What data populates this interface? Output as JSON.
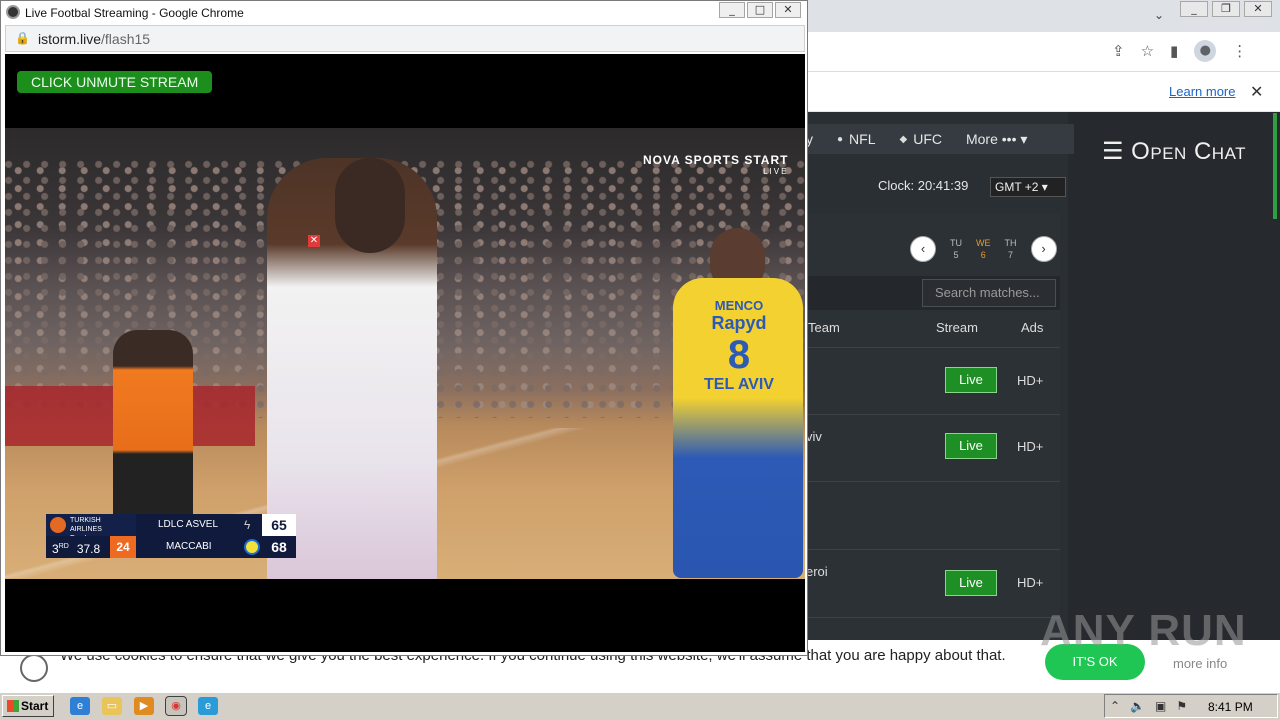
{
  "popup": {
    "title": "Live Footbal Streaming - Google Chrome",
    "url_host": "istorm.live",
    "url_path": "/flash15",
    "unmute_label": "CLICK UNMUTE STREAM",
    "window_buttons": [
      "_",
      "□",
      "✕"
    ]
  },
  "broadcast": {
    "channel": "NOVA SPORTS START",
    "channel_sub": "LIVE",
    "league": "TURKISH AIRLINES EuroLeague",
    "team1": "LDLC ASVEL",
    "score1": "65",
    "team2": "MACCABI",
    "score2": "68",
    "period": "3",
    "period_suffix": "RD",
    "game_clock": "37.8",
    "shot_clock": "24",
    "jersey_name": "MENCO",
    "jersey_brand": "Rapyd",
    "jersey_number": "8",
    "jersey_city": "TEL AVIV"
  },
  "site": {
    "nav": [
      {
        "icon": "",
        "label": "y"
      },
      {
        "icon": "●",
        "label": "NFL"
      },
      {
        "icon": "◆",
        "label": "UFC"
      },
      {
        "icon": "",
        "label": "More ••• ▾"
      }
    ],
    "open_chat": "☰ Open Chat",
    "clock": "Clock: 20:41:39",
    "timezone": "GMT +2 ▾",
    "days": [
      {
        "dow": "TU",
        "num": "5"
      },
      {
        "dow": "WE",
        "num": "6"
      },
      {
        "dow": "TH",
        "num": "7"
      }
    ],
    "search_placeholder": "Search matches...",
    "columns": {
      "team": "Team",
      "stream": "Stream",
      "ads": "Ads"
    },
    "rows": [
      {
        "team": "",
        "live": "Live",
        "ads": "HD+"
      },
      {
        "team": "viv",
        "live": "Live",
        "ads": "HD+"
      },
      {
        "team": "",
        "live": "",
        "ads": ""
      },
      {
        "team": "eroi",
        "live": "Live",
        "ads": "HD+"
      }
    ]
  },
  "notice": {
    "learn_more": "Learn more",
    "close": "✕"
  },
  "cookie": {
    "text": "We use cookies to ensure that we give you the best experience. If you continue using this website, we'll assume that you are happy about that.",
    "ok": "IT'S OK",
    "more": "more info"
  },
  "watermark": "ANY RUN",
  "taskbar": {
    "start": "Start",
    "time": "8:41 PM"
  },
  "colors": {
    "live_green": "#1e8f24",
    "accent_orange": "#e69b2a",
    "ok_green": "#1fc653"
  }
}
